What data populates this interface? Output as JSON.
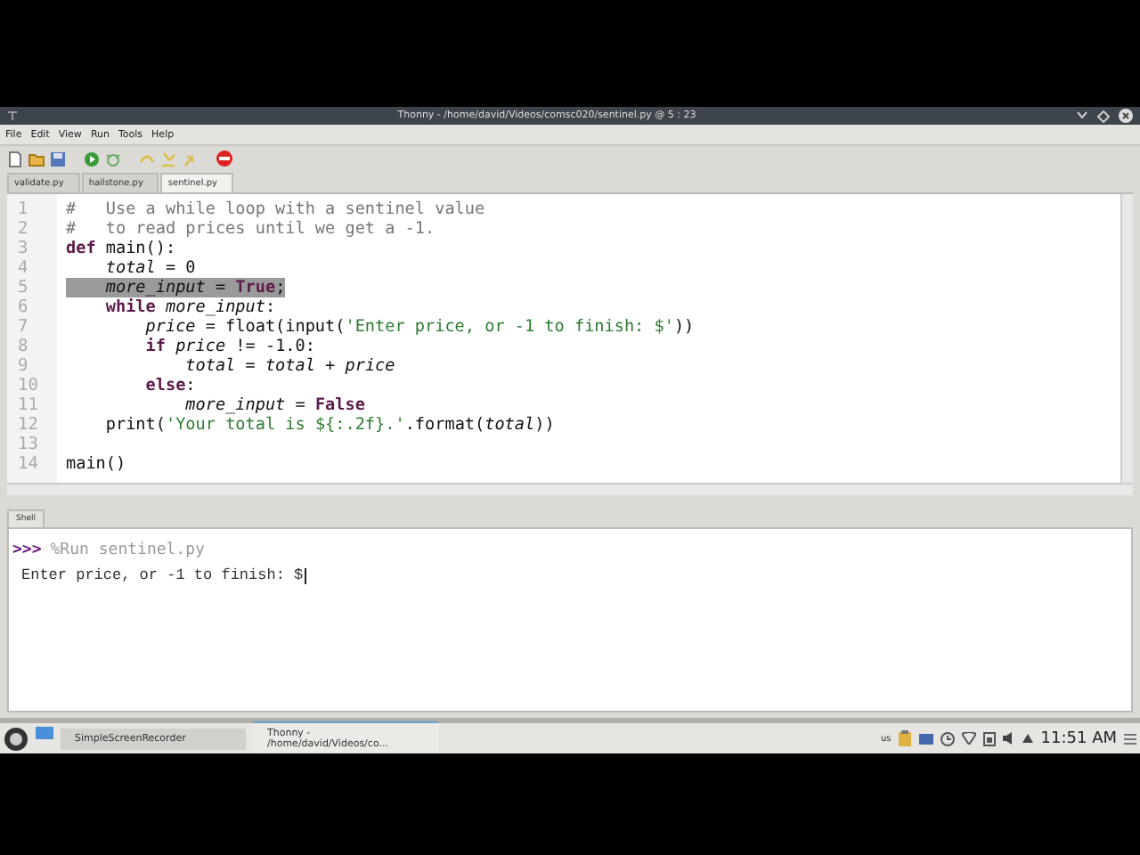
{
  "window": {
    "title": "Thonny - /home/david/Videos/comsc020/sentinel.py @ 5 : 23"
  },
  "menu": [
    "File",
    "Edit",
    "View",
    "Run",
    "Tools",
    "Help"
  ],
  "tabs": [
    {
      "label": "validate.py",
      "selected": false
    },
    {
      "label": "hailstone.py",
      "selected": false
    },
    {
      "label": "sentinel.py",
      "selected": true
    }
  ],
  "editor": {
    "lines": [
      {
        "number": "1",
        "highlighted": false,
        "tokens": [
          {
            "kind": "comment",
            "text": "#   Use a while loop with a sentinel value"
          }
        ]
      },
      {
        "number": "2",
        "highlighted": false,
        "tokens": [
          {
            "kind": "comment",
            "text": "#   to read prices until we get a -1."
          }
        ]
      },
      {
        "number": "3",
        "highlighted": false,
        "tokens": [
          {
            "kind": "keyword",
            "text": "def"
          },
          {
            "kind": "plain",
            "text": " main():"
          }
        ]
      },
      {
        "number": "4",
        "highlighted": false,
        "tokens": [
          {
            "kind": "local",
            "text": "    total"
          },
          {
            "kind": "plain",
            "text": " = 0"
          }
        ]
      },
      {
        "number": "5",
        "highlighted": true,
        "tokens": [
          {
            "kind": "local",
            "text": "    more_input"
          },
          {
            "kind": "plain",
            "text": " = "
          },
          {
            "kind": "constant",
            "text": "True"
          },
          {
            "kind": "plain",
            "text": ";"
          }
        ]
      },
      {
        "number": "6",
        "highlighted": false,
        "tokens": [
          {
            "kind": "keyword",
            "text": "    while "
          },
          {
            "kind": "local",
            "text": "more_input"
          },
          {
            "kind": "plain",
            "text": ":"
          }
        ]
      },
      {
        "number": "7",
        "highlighted": false,
        "tokens": [
          {
            "kind": "local",
            "text": "        price"
          },
          {
            "kind": "plain",
            "text": " = float(input("
          },
          {
            "kind": "string",
            "text": "'Enter price, or -1 to finish: $'"
          },
          {
            "kind": "plain",
            "text": "))"
          }
        ]
      },
      {
        "number": "8",
        "highlighted": false,
        "tokens": [
          {
            "kind": "keyword",
            "text": "        if "
          },
          {
            "kind": "local",
            "text": "price"
          },
          {
            "kind": "plain",
            "text": " != -1.0:"
          }
        ]
      },
      {
        "number": "9",
        "highlighted": false,
        "tokens": [
          {
            "kind": "local",
            "text": "            total"
          },
          {
            "kind": "plain",
            "text": " = "
          },
          {
            "kind": "local",
            "text": "total"
          },
          {
            "kind": "plain",
            "text": " + "
          },
          {
            "kind": "local",
            "text": "price"
          }
        ]
      },
      {
        "number": "10",
        "highlighted": false,
        "tokens": [
          {
            "kind": "keyword",
            "text": "        else"
          },
          {
            "kind": "plain",
            "text": ":"
          }
        ]
      },
      {
        "number": "11",
        "highlighted": false,
        "tokens": [
          {
            "kind": "local",
            "text": "            more_input"
          },
          {
            "kind": "plain",
            "text": " = "
          },
          {
            "kind": "constant",
            "text": "False"
          }
        ]
      },
      {
        "number": "12",
        "highlighted": false,
        "tokens": [
          {
            "kind": "plain",
            "text": "    print("
          },
          {
            "kind": "string",
            "text": "'Your total is ${:.2f}.'"
          },
          {
            "kind": "plain",
            "text": ".format("
          },
          {
            "kind": "local",
            "text": "total"
          },
          {
            "kind": "plain",
            "text": "))"
          }
        ]
      },
      {
        "number": "13",
        "highlighted": false
      },
      {
        "number": "14",
        "highlighted": false,
        "tokens": [
          {
            "kind": "plain",
            "text": "main()"
          }
        ]
      }
    ]
  },
  "shell": {
    "tab": "Shell",
    "prompt": ">>>",
    "command": "%Run sentinel.py",
    "output": "Enter price, or -1 to finish: $"
  },
  "taskbar": {
    "tasks": [
      {
        "label": "SimpleScreenRecorder",
        "selected": false
      },
      {
        "label": "Thonny - /home/david/Videos/co...",
        "selected": true
      }
    ],
    "keyboard": "us",
    "clock": "11:51 AM"
  }
}
